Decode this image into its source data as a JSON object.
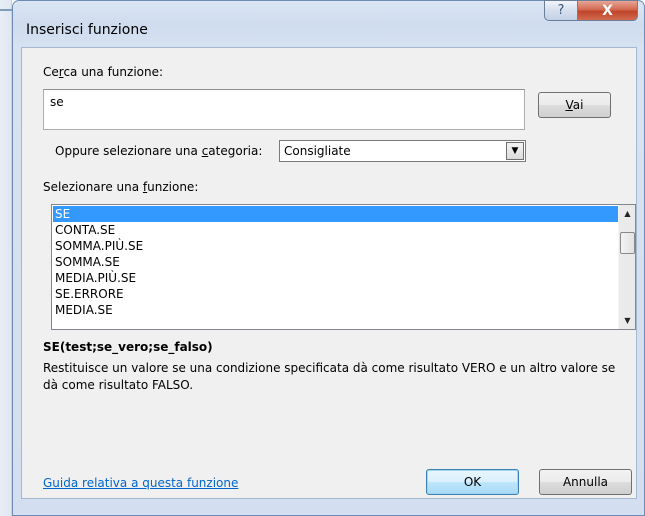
{
  "dialog": {
    "title": "Inserisci funzione",
    "help_glyph": "?",
    "close_glyph": "X"
  },
  "search": {
    "label": "Cerca una funzione:",
    "value": "se",
    "go_button": "Vai"
  },
  "category": {
    "label": "Oppure selezionare una categoria:",
    "selected": "Consigliate",
    "arrow_icon": "chevron-down-icon"
  },
  "function_list": {
    "label": "Selezionare una funzione:",
    "items": [
      "SE",
      "CONTA.SE",
      "SOMMA.PIÙ.SE",
      "SOMMA.SE",
      "MEDIA.PIÙ.SE",
      "SE.ERRORE",
      "MEDIA.SE"
    ],
    "selected_index": 0
  },
  "details": {
    "signature": "SE(test;se_vero;se_falso)",
    "description": "Restituisce un valore se una condizione specificata dà come risultato VERO e un altro valore se dà come risultato FALSO."
  },
  "footer": {
    "help_link": "Guida relativa a questa funzione",
    "ok": "OK",
    "cancel": "Annulla"
  },
  "colors": {
    "selection": "#3399ff",
    "link": "#0066cc",
    "close_button": "#c0442a"
  }
}
